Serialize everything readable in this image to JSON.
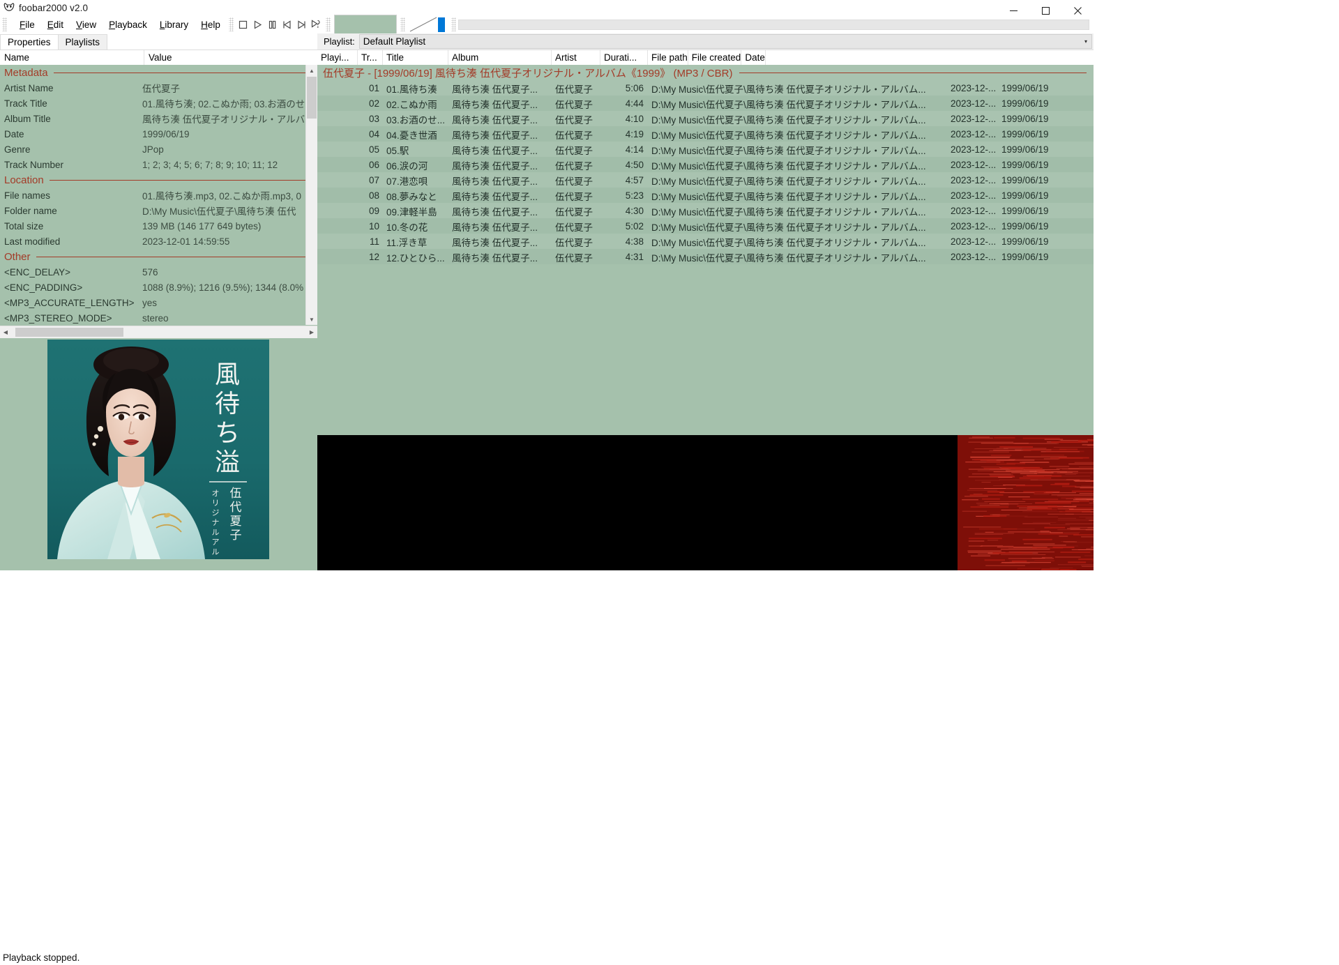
{
  "window": {
    "title": "foobar2000 v2.0",
    "icon": "foobar-icon",
    "minimize_label": "─",
    "maximize_label": "☐",
    "close_label": "✕"
  },
  "menu": {
    "items": [
      {
        "label": "File",
        "accel": "F"
      },
      {
        "label": "Edit",
        "accel": "E"
      },
      {
        "label": "View",
        "accel": "V"
      },
      {
        "label": "Playback",
        "accel": "P"
      },
      {
        "label": "Library",
        "accel": "L"
      },
      {
        "label": "Help",
        "accel": "H"
      }
    ]
  },
  "toolbar": {
    "buttons": [
      {
        "name": "stop-button",
        "icon": "stop-icon"
      },
      {
        "name": "play-button",
        "icon": "play-icon"
      },
      {
        "name": "pause-button",
        "icon": "pause-icon"
      },
      {
        "name": "previous-button",
        "icon": "previous-icon"
      },
      {
        "name": "next-button",
        "icon": "next-icon"
      },
      {
        "name": "random-button",
        "icon": "random-icon"
      }
    ],
    "album_art_thumb": "album-art-thumbnail",
    "volume_slider": "volume-slider",
    "seek_bar": "seek-bar"
  },
  "left_panel": {
    "tabs": [
      {
        "label": "Properties",
        "active": true
      },
      {
        "label": "Playlists",
        "active": false
      }
    ],
    "columns": {
      "name": "Name",
      "value": "Value"
    },
    "groups": [
      {
        "title": "Metadata",
        "rows": [
          {
            "name": "Artist Name",
            "value": "伍代夏子"
          },
          {
            "name": "Track Title",
            "value": "01.風待ち湊; 02.こぬか雨; 03.お酒のせ"
          },
          {
            "name": "Album Title",
            "value": "風待ち湊 伍代夏子オリジナル・アルバ"
          },
          {
            "name": "Date",
            "value": "1999/06/19"
          },
          {
            "name": "Genre",
            "value": "JPop"
          },
          {
            "name": "Track Number",
            "value": "1; 2; 3; 4; 5; 6; 7; 8; 9; 10; 11; 12"
          }
        ]
      },
      {
        "title": "Location",
        "rows": [
          {
            "name": "File names",
            "value": "01.風待ち湊.mp3, 02.こぬか雨.mp3, 0"
          },
          {
            "name": "Folder name",
            "value": "D:\\My Music\\伍代夏子\\風待ち湊 伍代"
          },
          {
            "name": "Total size",
            "value": "139 MB (146 177 649 bytes)"
          },
          {
            "name": "Last modified",
            "value": "2023-12-01 14:59:55"
          }
        ]
      },
      {
        "title": "Other",
        "rows": [
          {
            "name": "<ENC_DELAY>",
            "value": "576"
          },
          {
            "name": "<ENC_PADDING>",
            "value": "1088 (8.9%); 1216 (9.5%); 1344 (8.0%"
          },
          {
            "name": "<MP3_ACCURATE_LENGTH>",
            "value": "yes"
          },
          {
            "name": "<MP3_STEREO_MODE>",
            "value": "stereo"
          }
        ]
      }
    ],
    "scroll_up": "▲",
    "scroll_down": "▼",
    "scroll_left": "◀",
    "scroll_right": "▶"
  },
  "album_art": {
    "name": "album-cover-image",
    "album_title_vertical": "風待ち湊",
    "subtitle_vertical": "伍代夏子",
    "subtitle2_vertical": "オリジナル・アルバム",
    "background_color": "#1d6e6e"
  },
  "playlist": {
    "label": "Playlist:",
    "selected": "Default Playlist",
    "caret": "▾",
    "columns": [
      {
        "key": "playing",
        "label": "Playi..."
      },
      {
        "key": "track",
        "label": "Tr..."
      },
      {
        "key": "title",
        "label": "Title"
      },
      {
        "key": "album",
        "label": "Album"
      },
      {
        "key": "artist",
        "label": "Artist"
      },
      {
        "key": "duration",
        "label": "Durati..."
      },
      {
        "key": "filepath",
        "label": "File path"
      },
      {
        "key": "filecreated",
        "label": "File created"
      },
      {
        "key": "date",
        "label": "Date"
      }
    ],
    "group_header": "伍代夏子 - [1999/06/19] 風待ち湊 伍代夏子オリジナル・アルバム《1999》 (MP3 / CBR)",
    "rows": [
      {
        "playing": "",
        "track": "01",
        "title": "01.風待ち湊",
        "album": "風待ち湊 伍代夏子...",
        "artist": "伍代夏子",
        "duration": "5:06",
        "filepath": "D:\\My Music\\伍代夏子\\風待ち湊 伍代夏子オリジナル・アルバム...",
        "filecreated": "2023-12-...",
        "date": "1999/06/19"
      },
      {
        "playing": "",
        "track": "02",
        "title": "02.こぬか雨",
        "album": "風待ち湊 伍代夏子...",
        "artist": "伍代夏子",
        "duration": "4:44",
        "filepath": "D:\\My Music\\伍代夏子\\風待ち湊 伍代夏子オリジナル・アルバム...",
        "filecreated": "2023-12-...",
        "date": "1999/06/19"
      },
      {
        "playing": "",
        "track": "03",
        "title": "03.お酒のせ...",
        "album": "風待ち湊 伍代夏子...",
        "artist": "伍代夏子",
        "duration": "4:10",
        "filepath": "D:\\My Music\\伍代夏子\\風待ち湊 伍代夏子オリジナル・アルバム...",
        "filecreated": "2023-12-...",
        "date": "1999/06/19"
      },
      {
        "playing": "",
        "track": "04",
        "title": "04.憂き世酒",
        "album": "風待ち湊 伍代夏子...",
        "artist": "伍代夏子",
        "duration": "4:19",
        "filepath": "D:\\My Music\\伍代夏子\\風待ち湊 伍代夏子オリジナル・アルバム...",
        "filecreated": "2023-12-...",
        "date": "1999/06/19"
      },
      {
        "playing": "",
        "track": "05",
        "title": "05.駅",
        "album": "風待ち湊 伍代夏子...",
        "artist": "伍代夏子",
        "duration": "4:14",
        "filepath": "D:\\My Music\\伍代夏子\\風待ち湊 伍代夏子オリジナル・アルバム...",
        "filecreated": "2023-12-...",
        "date": "1999/06/19"
      },
      {
        "playing": "",
        "track": "06",
        "title": "06.涙の河",
        "album": "風待ち湊 伍代夏子...",
        "artist": "伍代夏子",
        "duration": "4:50",
        "filepath": "D:\\My Music\\伍代夏子\\風待ち湊 伍代夏子オリジナル・アルバム...",
        "filecreated": "2023-12-...",
        "date": "1999/06/19"
      },
      {
        "playing": "",
        "track": "07",
        "title": "07.港恋唄",
        "album": "風待ち湊 伍代夏子...",
        "artist": "伍代夏子",
        "duration": "4:57",
        "filepath": "D:\\My Music\\伍代夏子\\風待ち湊 伍代夏子オリジナル・アルバム...",
        "filecreated": "2023-12-...",
        "date": "1999/06/19"
      },
      {
        "playing": "",
        "track": "08",
        "title": "08.夢みなと",
        "album": "風待ち湊 伍代夏子...",
        "artist": "伍代夏子",
        "duration": "5:23",
        "filepath": "D:\\My Music\\伍代夏子\\風待ち湊 伍代夏子オリジナル・アルバム...",
        "filecreated": "2023-12-...",
        "date": "1999/06/19"
      },
      {
        "playing": "",
        "track": "09",
        "title": "09.津軽半島",
        "album": "風待ち湊 伍代夏子...",
        "artist": "伍代夏子",
        "duration": "4:30",
        "filepath": "D:\\My Music\\伍代夏子\\風待ち湊 伍代夏子オリジナル・アルバム...",
        "filecreated": "2023-12-...",
        "date": "1999/06/19"
      },
      {
        "playing": "",
        "track": "10",
        "title": "10.冬の花",
        "album": "風待ち湊 伍代夏子...",
        "artist": "伍代夏子",
        "duration": "5:02",
        "filepath": "D:\\My Music\\伍代夏子\\風待ち湊 伍代夏子オリジナル・アルバム...",
        "filecreated": "2023-12-...",
        "date": "1999/06/19"
      },
      {
        "playing": "",
        "track": "11",
        "title": "11.浮き草",
        "album": "風待ち湊 伍代夏子...",
        "artist": "伍代夏子",
        "duration": "4:38",
        "filepath": "D:\\My Music\\伍代夏子\\風待ち湊 伍代夏子オリジナル・アルバム...",
        "filecreated": "2023-12-...",
        "date": "1999/06/19"
      },
      {
        "playing": "",
        "track": "12",
        "title": "12.ひとひら...",
        "album": "風待ち湊 伍代夏子...",
        "artist": "伍代夏子",
        "duration": "4:31",
        "filepath": "D:\\My Music\\伍代夏子\\風待ち湊 伍代夏子オリジナル・アルバム...",
        "filecreated": "2023-12-...",
        "date": "1999/06/19"
      }
    ]
  },
  "visualization": {
    "name": "spectrogram-visualization",
    "background": "#000000",
    "accent": "#cc1111"
  },
  "status": {
    "text": "Playback stopped."
  },
  "colors": {
    "panel_green": "#a5c1ac",
    "row_light": "#a9c3b0",
    "row_dark": "#a1bda9",
    "group_red": "#a33b28",
    "accent_blue": "#0078d7"
  }
}
